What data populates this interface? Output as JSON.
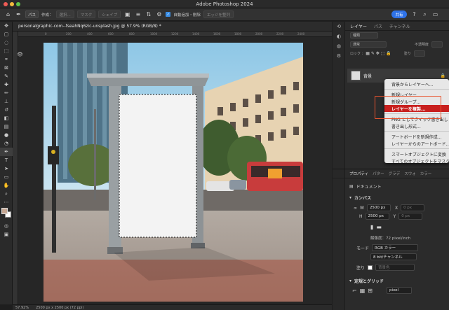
{
  "window": {
    "title": "Adobe Photoshop 2024"
  },
  "options_bar": {
    "mode_label": "パス",
    "make_label": "作成：",
    "select_button": "選択...",
    "mask_button": "マスク",
    "shape_button": "シェイプ",
    "auto_add_label": "自動追加・削除",
    "align_edges_label": "エッジを整列",
    "share_label": "共有"
  },
  "document": {
    "tab_label": "personalgraphic-com--fseahNq6zic-unsplash.jpg @ 57.9% (RGB/8) *",
    "ruler_ticks": [
      "0",
      "200",
      "400",
      "600",
      "800",
      "1000",
      "1200",
      "1400",
      "1600",
      "1800",
      "2000",
      "2200",
      "2400"
    ]
  },
  "status_bar": {
    "zoom": "57.92%",
    "size": "2500 px x 2500 px (72 ppi)"
  },
  "layers_panel": {
    "tabs": [
      "レイヤー",
      "パス",
      "チャンネル"
    ],
    "kind_filter": "種類",
    "blend_mode": "通常",
    "opacity_label": "不透明度",
    "lock_label": "ロック :",
    "fill_label": "塗り",
    "layer_name": "背景"
  },
  "context_menu": {
    "items": [
      "背景からレイヤーへ...",
      "新規レイヤー...",
      "新規グループ...",
      "レイヤーを複製...",
      "PNG としてクイック書き出し",
      "書き出し形式...",
      "アートボードを新規作成...",
      "レイヤーからのアートボード...",
      "スマートオブジェクトに変換",
      "すべてのオブジェクトをマスク"
    ],
    "highlighted_index": 3
  },
  "properties_panel": {
    "tabs": [
      "プロパティ",
      "パター",
      "グラデ",
      "スウォ",
      "カラー"
    ],
    "document_label": "ドキュメント",
    "canvas_heading": "カンバス",
    "width_label": "W",
    "width_value": "2500 px",
    "height_label": "H",
    "height_value": "2500 px",
    "x_label": "X",
    "x_value": "0 px",
    "y_label": "Y",
    "y_value": "0 px",
    "resolution": "解像度：72 pixel/inch",
    "mode_label": "モード",
    "mode_value": "RGB カラー",
    "bit_value": "8 bit/チャンネル",
    "fill_label": "塗り",
    "fill_value": "背景色",
    "rulers_heading": "定規とグリッド",
    "units_value": "pixel"
  },
  "colors": {
    "accent": "#2e72e8",
    "menu_highlight": "#c8201e",
    "outline": "#e8542f",
    "foreground_swatch": "#c7a894"
  }
}
